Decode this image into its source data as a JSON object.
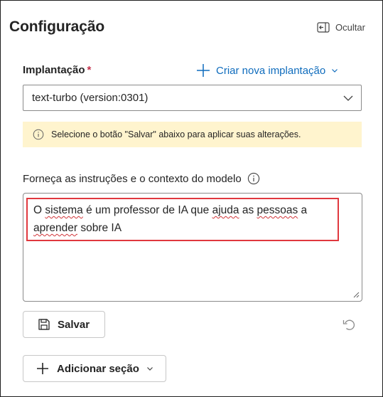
{
  "header": {
    "title": "Configuração",
    "hide_label": "Ocultar"
  },
  "deployment": {
    "label": "Implantação",
    "required_marker": "*",
    "create_link": "Criar nova implantação",
    "selected_value": "text-turbo (version:0301)"
  },
  "notice": {
    "text": "Selecione o botão \"Salvar\" abaixo para aplicar suas alterações."
  },
  "instructions": {
    "label": "Forneça as instruções e o contexto do modelo",
    "text_parts": [
      "O ",
      "sistema",
      " é um professor de IA que ",
      "ajuda",
      " as ",
      "pessoas",
      " a ",
      "aprender",
      " sobre IA"
    ]
  },
  "actions": {
    "save_label": "Salvar",
    "add_section_label": "Adicionar seção"
  },
  "colors": {
    "link": "#0f6cbd",
    "required": "#c4314b",
    "notice_bg": "#fff4ce",
    "highlight": "#e0383e"
  }
}
